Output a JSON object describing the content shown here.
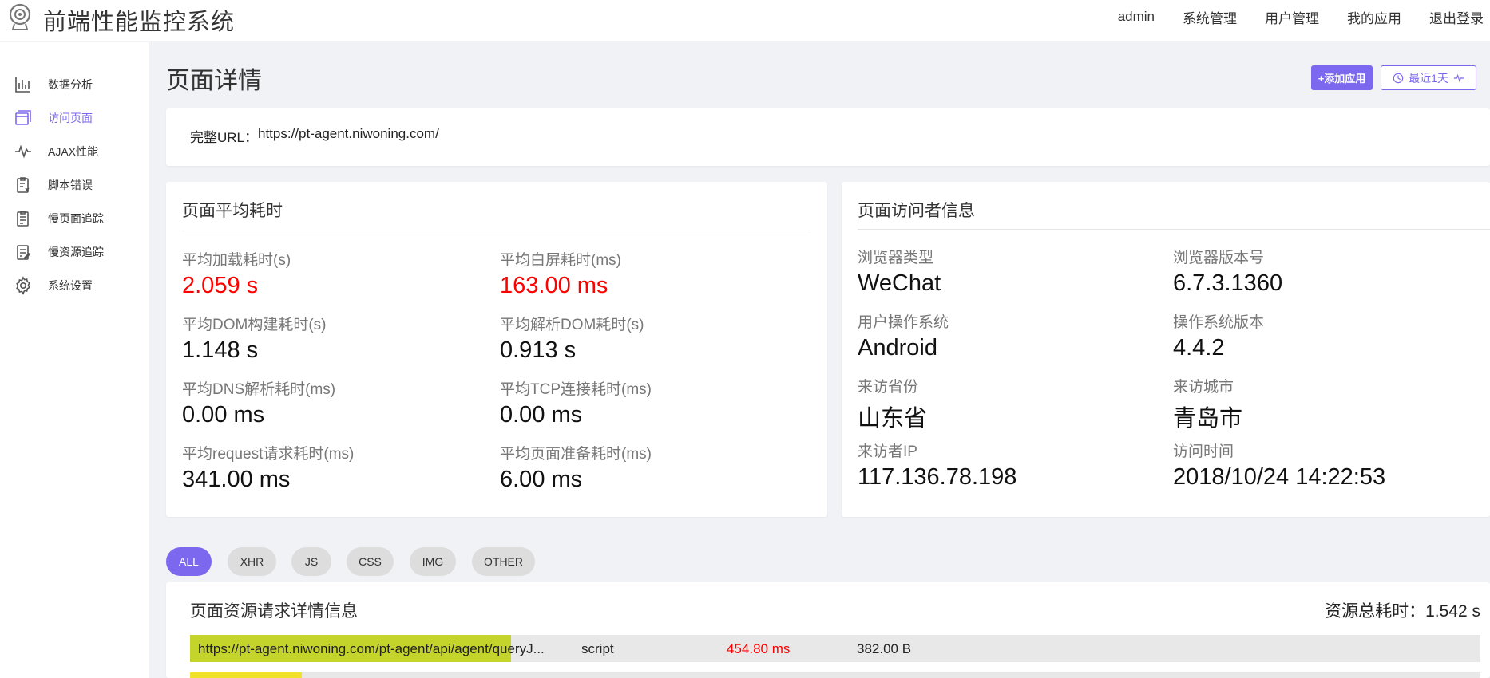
{
  "header": {
    "title": "前端性能监控系统",
    "nav": [
      "admin",
      "系统管理",
      "用户管理",
      "我的应用",
      "退出登录"
    ]
  },
  "sidebar": {
    "items": [
      {
        "label": "数据分析",
        "icon": "bar-chart-icon"
      },
      {
        "label": "访问页面",
        "icon": "window-icon",
        "active": true
      },
      {
        "label": "AJAX性能",
        "icon": "pulse-icon"
      },
      {
        "label": "脚本错误",
        "icon": "clipboard-x-icon"
      },
      {
        "label": "慢页面追踪",
        "icon": "clipboard-list-icon"
      },
      {
        "label": "慢资源追踪",
        "icon": "clipboard-edit-icon"
      },
      {
        "label": "系统设置",
        "icon": "gear-icon"
      }
    ]
  },
  "page": {
    "title": "页面详情",
    "add_button": "+添加应用",
    "range_button": "最近1天",
    "accent": "#7b68ee"
  },
  "url": {
    "label": "完整URL：",
    "value": "https://pt-agent.niwoning.com/"
  },
  "perf": {
    "title": "页面平均耗时",
    "metrics": [
      {
        "label": "平均加载耗时(s)",
        "value": "2.059 s"
      },
      {
        "label": "平均白屏耗时(ms)",
        "value": "163.00 ms"
      },
      {
        "label": "平均DOM构建耗时(s)",
        "value": "1.148 s"
      },
      {
        "label": "平均解析DOM耗时(s)",
        "value": "0.913 s"
      },
      {
        "label": "平均DNS解析耗时(ms)",
        "value": "0.00 ms"
      },
      {
        "label": "平均TCP连接耗时(ms)",
        "value": "0.00 ms"
      },
      {
        "label": "平均request请求耗时(ms)",
        "value": "341.00 ms"
      },
      {
        "label": "平均页面准备耗时(ms)",
        "value": "6.00 ms"
      }
    ]
  },
  "visitor": {
    "title": "页面访问者信息",
    "fields": [
      {
        "label": "浏览器类型",
        "value": "WeChat"
      },
      {
        "label": "浏览器版本号",
        "value": "6.7.3.1360"
      },
      {
        "label": "用户操作系统",
        "value": "Android"
      },
      {
        "label": "操作系统版本",
        "value": "4.4.2"
      },
      {
        "label": "来访省份",
        "value": "山东省"
      },
      {
        "label": "来访城市",
        "value": "青岛市"
      },
      {
        "label": "来访者IP",
        "value": "117.136.78.198"
      },
      {
        "label": "访问时间",
        "value": "2018/10/24 14:22:53"
      }
    ]
  },
  "filters": [
    "ALL",
    "XHR",
    "JS",
    "CSS",
    "IMG",
    "OTHER"
  ],
  "resources": {
    "title": "页面资源请求详情信息",
    "total_label": "资源总耗时：",
    "total_value": "1.542 s",
    "rows": [
      {
        "url": "https://pt-agent.niwoning.com/pt-agent/api/agent/queryJ...",
        "type": "script",
        "duration": "454.80 ms",
        "size": "382.00 B",
        "bar_fraction": 0.249
      }
    ]
  }
}
